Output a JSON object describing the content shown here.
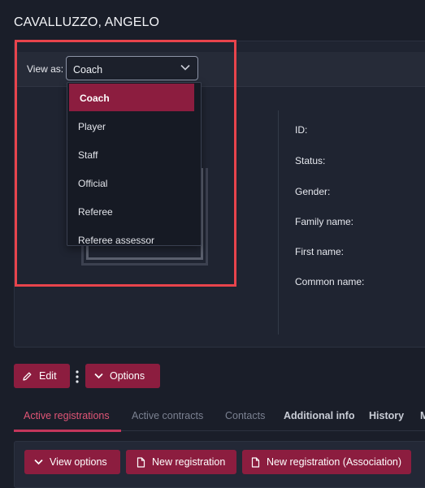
{
  "page": {
    "title": "CAVALLUZZO, ANGELO"
  },
  "view_as": {
    "label": "View as:",
    "selected": "Coach",
    "options": [
      "Coach",
      "Player",
      "Staff",
      "Official",
      "Referee",
      "Referee assessor"
    ]
  },
  "details": {
    "fields": [
      "ID:",
      "Status:",
      "Gender:",
      "Family name:",
      "First name:",
      "Common name:"
    ]
  },
  "actions": {
    "edit": "Edit",
    "options": "Options"
  },
  "tabs": [
    "Active registrations",
    "Active contracts",
    "Contacts",
    "Additional info",
    "History",
    "M"
  ],
  "toolbar": {
    "view_options": "View options",
    "new_registration": "New registration",
    "new_registration_assoc": "New registration (Association)"
  },
  "colors": {
    "accent": "#8c1d3f",
    "highlight": "#e8444c",
    "tab_active": "#e15576"
  }
}
